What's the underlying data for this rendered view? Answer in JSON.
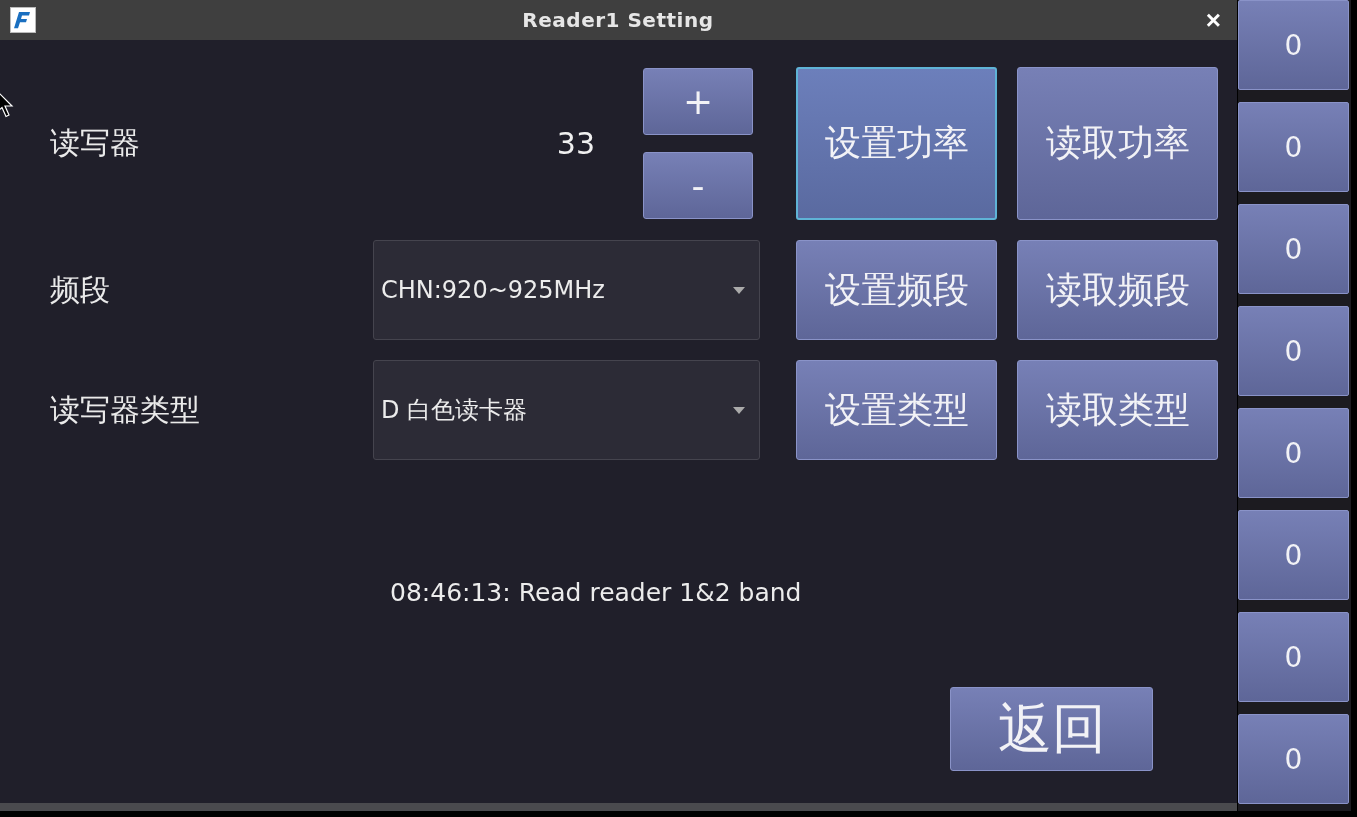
{
  "window": {
    "title": "Reader1 Setting",
    "close": "×"
  },
  "power": {
    "label": "读写器",
    "value": "33",
    "increase": "+",
    "decrease": "-"
  },
  "rows": [
    {
      "kind": "power",
      "buttons": [
        {
          "label": "设置功率",
          "focused": true
        },
        {
          "label": "读取功率",
          "focused": false
        }
      ]
    },
    {
      "kind": "select",
      "label": "频段",
      "value": "CHN:920~925MHz",
      "buttons": [
        {
          "label": "设置频段",
          "focused": false
        },
        {
          "label": "读取频段",
          "focused": false
        }
      ]
    },
    {
      "kind": "select",
      "label": "读写器类型",
      "value": "D 白色读卡器",
      "buttons": [
        {
          "label": "设置类型",
          "focused": false
        },
        {
          "label": "读取类型",
          "focused": false
        }
      ]
    }
  ],
  "status": "08:46:13: Read reader 1&2 band",
  "back_button": "返回",
  "side_buttons": [
    "0",
    "0",
    "0",
    "0",
    "0",
    "0",
    "0",
    "0"
  ]
}
